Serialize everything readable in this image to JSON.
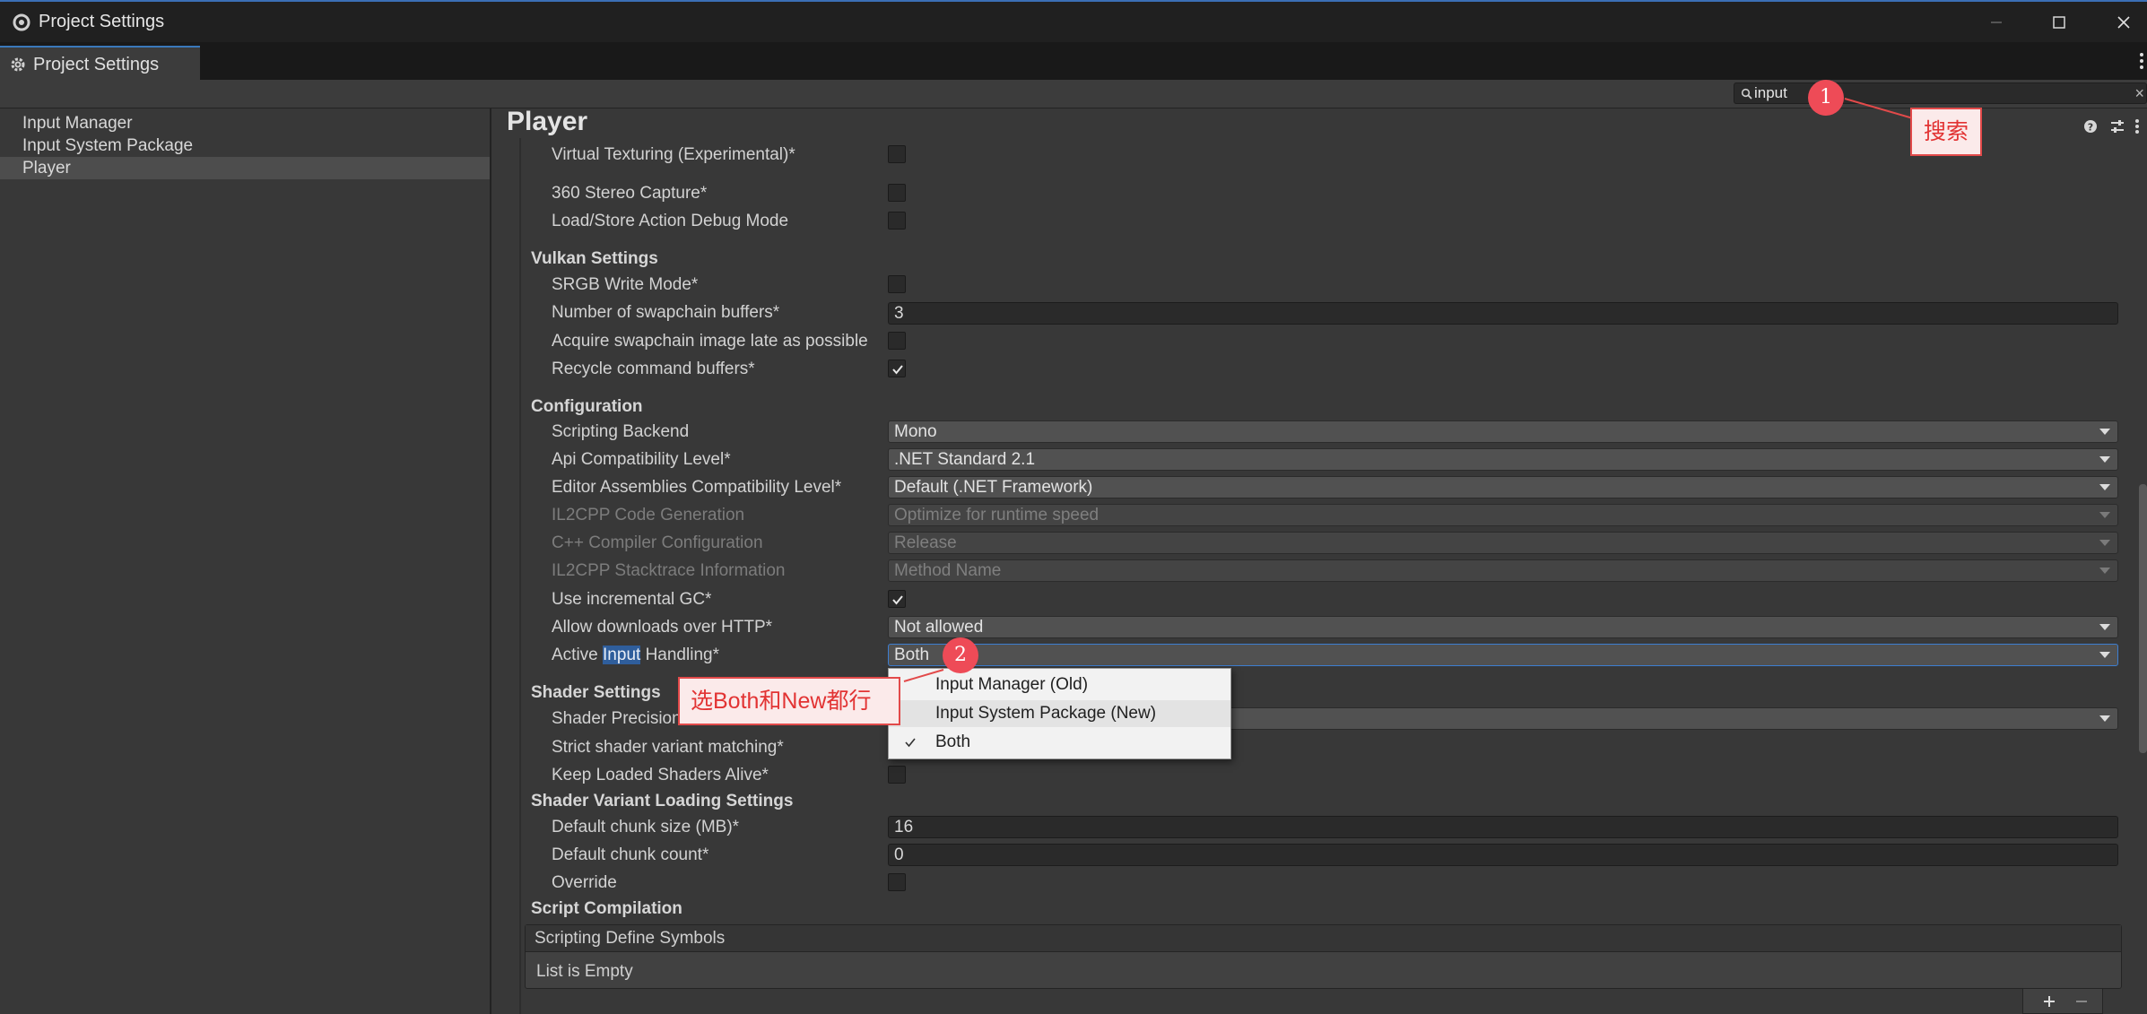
{
  "window": {
    "title": "Project Settings",
    "tab_label": "Project Settings"
  },
  "search": {
    "value": "input"
  },
  "sidebar": {
    "items": [
      "Input Manager",
      "Input System Package",
      "Player"
    ]
  },
  "main": {
    "title": "Player",
    "rows": {
      "virtual_texturing": "Virtual Texturing (Experimental)*",
      "stereo_capture": "360 Stereo Capture*",
      "load_store_debug": "Load/Store Action Debug Mode",
      "vulkan_header": "Vulkan Settings",
      "srgb_write": "SRGB Write Mode*",
      "swapchain_buffers": "Number of swapchain buffers*",
      "swapchain_buffers_value": "3",
      "acquire_swapchain": "Acquire swapchain image late as possible",
      "recycle_buffers": "Recycle command buffers*",
      "configuration_header": "Configuration",
      "scripting_backend": "Scripting Backend",
      "scripting_backend_value": "Mono",
      "api_compat": "Api Compatibility Level*",
      "api_compat_value": ".NET Standard 2.1",
      "editor_compat": "Editor Assemblies Compatibility Level*",
      "editor_compat_value": "Default (.NET Framework)",
      "il2cpp_codegen": "IL2CPP Code Generation",
      "il2cpp_codegen_value": "Optimize for runtime speed",
      "cpp_compiler": "C++ Compiler Configuration",
      "cpp_compiler_value": "Release",
      "il2cpp_stacktrace": "IL2CPP Stacktrace Information",
      "il2cpp_stacktrace_value": "Method Name",
      "incremental_gc": "Use incremental GC*",
      "allow_http": "Allow downloads over HTTP*",
      "allow_http_value": "Not allowed",
      "active_input_pre": "Active ",
      "active_input_hl": "Input",
      "active_input_post": " Handling*",
      "active_input_value": "Both",
      "shader_header": "Shader Settings",
      "shader_precision": "Shader Precision Model*",
      "strict_shader": "Strict shader variant matching*",
      "keep_shaders": "Keep Loaded Shaders Alive*",
      "variant_loading_header": "Shader Variant Loading Settings",
      "chunk_size": "Default chunk size (MB)*",
      "chunk_size_value": "16",
      "chunk_count": "Default chunk count*",
      "chunk_count_value": "0",
      "override": "Override",
      "script_compilation_header": "Script Compilation",
      "define_symbols": "Scripting Define Symbols",
      "list_empty": "List is Empty"
    }
  },
  "popup": {
    "options": [
      "Input Manager (Old)",
      "Input System Package (New)",
      "Both"
    ],
    "selected": "Both"
  },
  "annotations": {
    "badge1": "1",
    "note1": "搜索",
    "badge2": "2",
    "note2": "选Both和New都行"
  },
  "colors": {
    "accent": "#3b79bb",
    "annotation_red": "#e24a4a",
    "badge": "#ee4b57"
  }
}
